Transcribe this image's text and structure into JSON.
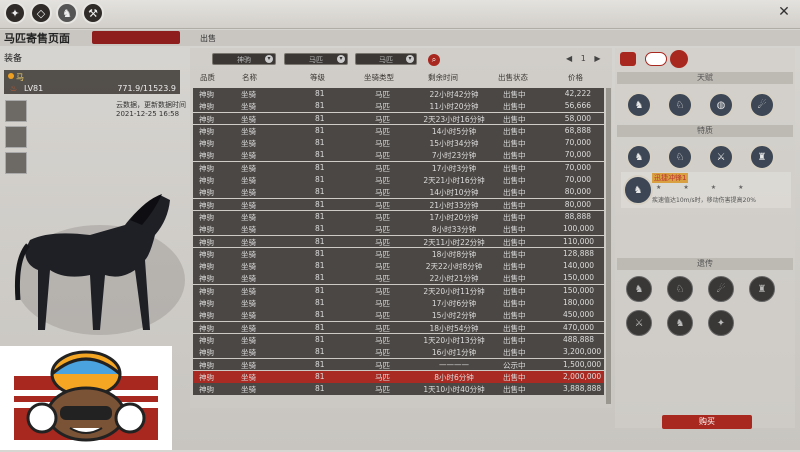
{
  "header": {
    "icons": [
      "medal-icon",
      "map-icon",
      "horse-icon",
      "hammer-icon"
    ],
    "close_label": "✕"
  },
  "title": {
    "page_title": "马匹寄售页面",
    "sale_tab": "出售"
  },
  "left": {
    "equip_title": "装备",
    "horse_name": "马",
    "horse_level": "LV81",
    "horse_xp": "771.9/11523.9",
    "cloud_note": "云数据，更新数据时间",
    "update_time": "2021-12-25 16:58"
  },
  "filters": {
    "dd1": "神驹",
    "dd2": "马匹",
    "dd3": "马匹",
    "page_prefix": "◀",
    "page_number": "1",
    "page_suffix": "▶"
  },
  "table": {
    "headers": [
      "品质",
      "名称",
      "等级",
      "坐骑类型",
      "剩余时间",
      "出售状态",
      "价格"
    ],
    "rows": [
      [
        "神驹",
        "坐骑",
        "81",
        "马匹",
        "22小时42分钟",
        "出售中",
        "42,222"
      ],
      [
        "神驹",
        "坐骑",
        "81",
        "马匹",
        "11小时20分钟",
        "出售中",
        "56,666"
      ],
      [
        "神驹",
        "坐骑",
        "81",
        "马匹",
        "2天23小时16分钟",
        "出售中",
        "58,000"
      ],
      [
        "神驹",
        "坐骑",
        "81",
        "马匹",
        "14小时5分钟",
        "出售中",
        "68,888"
      ],
      [
        "神驹",
        "坐骑",
        "81",
        "马匹",
        "15小时34分钟",
        "出售中",
        "70,000"
      ],
      [
        "神驹",
        "坐骑",
        "81",
        "马匹",
        "7小时23分钟",
        "出售中",
        "70,000"
      ],
      [
        "神驹",
        "坐骑",
        "81",
        "马匹",
        "17小时3分钟",
        "出售中",
        "70,000"
      ],
      [
        "神驹",
        "坐骑",
        "81",
        "马匹",
        "2天21小时16分钟",
        "出售中",
        "70,000"
      ],
      [
        "神驹",
        "坐骑",
        "81",
        "马匹",
        "14小时10分钟",
        "出售中",
        "80,000"
      ],
      [
        "神驹",
        "坐骑",
        "81",
        "马匹",
        "21小时33分钟",
        "出售中",
        "80,000"
      ],
      [
        "神驹",
        "坐骑",
        "81",
        "马匹",
        "17小时20分钟",
        "出售中",
        "88,888"
      ],
      [
        "神驹",
        "坐骑",
        "81",
        "马匹",
        "8小时33分钟",
        "出售中",
        "100,000"
      ],
      [
        "神驹",
        "坐骑",
        "81",
        "马匹",
        "2天11小时22分钟",
        "出售中",
        "110,000"
      ],
      [
        "神驹",
        "坐骑",
        "81",
        "马匹",
        "18小时8分钟",
        "出售中",
        "128,888"
      ],
      [
        "神驹",
        "坐骑",
        "81",
        "马匹",
        "2天22小时8分钟",
        "出售中",
        "140,000"
      ],
      [
        "神驹",
        "坐骑",
        "81",
        "马匹",
        "22小时21分钟",
        "出售中",
        "150,000"
      ],
      [
        "神驹",
        "坐骑",
        "81",
        "马匹",
        "2天20小时11分钟",
        "出售中",
        "150,000"
      ],
      [
        "神驹",
        "坐骑",
        "81",
        "马匹",
        "17小时6分钟",
        "出售中",
        "180,000"
      ],
      [
        "神驹",
        "坐骑",
        "81",
        "马匹",
        "15小时2分钟",
        "出售中",
        "450,000"
      ],
      [
        "神驹",
        "坐骑",
        "81",
        "马匹",
        "18小时54分钟",
        "出售中",
        "470,000"
      ],
      [
        "神驹",
        "坐骑",
        "81",
        "马匹",
        "1天20小时13分钟",
        "出售中",
        "488,888"
      ],
      [
        "神驹",
        "坐骑",
        "81",
        "马匹",
        "16小时1分钟",
        "出售中",
        "3,200,000"
      ],
      [
        "神驹",
        "坐骑",
        "81",
        "马匹",
        "————",
        "公示中",
        "1,500,000"
      ],
      [
        "神驹",
        "坐骑",
        "81",
        "马匹",
        "8小时6分钟",
        "出售中",
        "2,000,000"
      ],
      [
        "神驹",
        "坐骑",
        "81",
        "马匹",
        "1天10小时40分钟",
        "出售中",
        "3,888,888"
      ]
    ],
    "highlight_index": 23
  },
  "right": {
    "talent_title": "天赋",
    "trait_title": "特质",
    "gene_title": "遗传",
    "trait_name": "迅捷冲锋1",
    "trait_desc": "疾速值达10m/s时，移动伤害提高20%",
    "buy_label": "购买"
  },
  "colors": {
    "accent_red": "#a8281f",
    "row_dark": "#4b4744",
    "row_highlight": "#a82a22"
  }
}
